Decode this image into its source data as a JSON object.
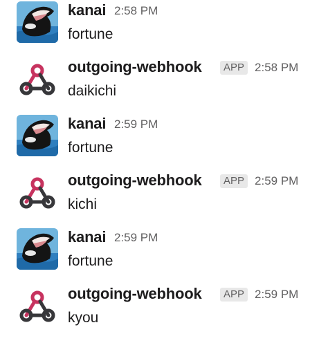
{
  "messages": [
    {
      "user": "kanai",
      "time": "2:58 PM",
      "text": "fortune",
      "avatar": "orca-photo"
    },
    {
      "user": "outgoing-webhook",
      "badge": "APP",
      "time": "2:58 PM",
      "text": "daikichi",
      "avatar": "webhook-icon"
    },
    {
      "user": "kanai",
      "time": "2:59 PM",
      "text": "fortune",
      "avatar": "orca-photo"
    },
    {
      "user": "outgoing-webhook",
      "badge": "APP",
      "time": "2:59 PM",
      "text": "kichi",
      "avatar": "webhook-icon"
    },
    {
      "user": "kanai",
      "time": "2:59 PM",
      "text": "fortune",
      "avatar": "orca-photo"
    },
    {
      "user": "outgoing-webhook",
      "badge": "APP",
      "time": "2:59 PM",
      "text": "kyou",
      "avatar": "webhook-icon"
    }
  ],
  "colors": {
    "webhook_pink": "#c7335f",
    "webhook_dark": "#37373a",
    "orca_water": "#3f8fc9"
  }
}
